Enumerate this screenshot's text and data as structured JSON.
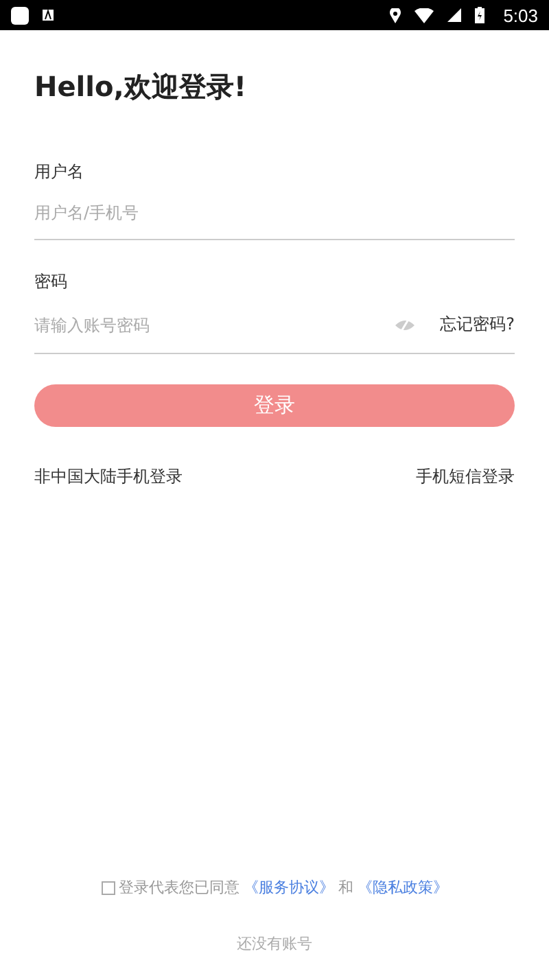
{
  "status_bar": {
    "time": "5:03"
  },
  "title": "Hello,欢迎登录!",
  "fields": [
    {
      "label": "用户名",
      "placeholder": "用户名/手机号",
      "kind": "text"
    },
    {
      "label": "密码",
      "placeholder": "请输入账号密码",
      "kind": "password",
      "link": "忘记密码?"
    }
  ],
  "login_button": {
    "label": "登录",
    "disabled": true
  },
  "links": [
    "非中国大陆手机登录",
    "手机短信登录"
  ],
  "agreement": {
    "checked": false,
    "text": "登录代表您已同意",
    "links": [
      "《服务协议》",
      "《隐私政策》"
    ],
    "joiner": "和"
  },
  "register": {
    "text": "还没有账号"
  }
}
